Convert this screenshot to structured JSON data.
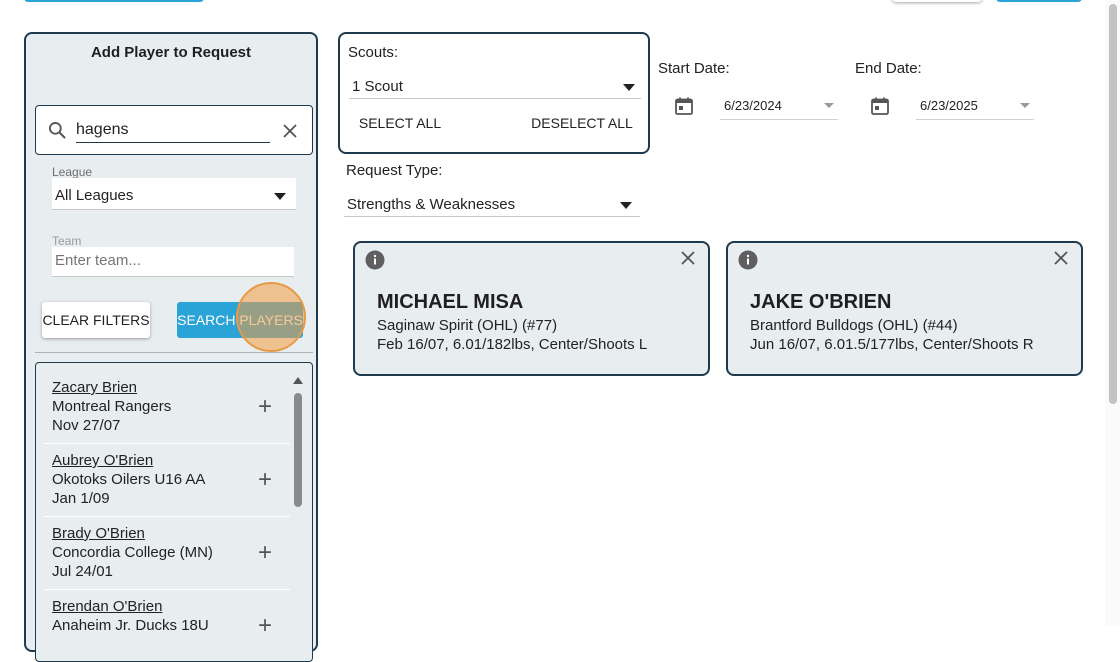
{
  "left_panel": {
    "title": "Add Player to Request",
    "search": {
      "value": "hagens",
      "placeholder": ""
    },
    "league": {
      "label": "League",
      "value": "All Leagues"
    },
    "team": {
      "label": "Team",
      "placeholder": "Enter team..."
    },
    "clear_filters_label": "CLEAR FILTERS",
    "search_players_label": "SEARCH PLAYERS",
    "results": [
      {
        "name": "Zacary Brien",
        "team": "Montreal Rangers",
        "dob": "Nov 27/07"
      },
      {
        "name": "Aubrey O'Brien",
        "team": "Okotoks Oilers U16 AA",
        "dob": "Jan 1/09"
      },
      {
        "name": "Brady O'Brien",
        "team": "Concordia College (MN)",
        "dob": "Jul 24/01"
      },
      {
        "name": "Brendan O'Brien",
        "team": "Anaheim Jr. Ducks 18U",
        "dob": ""
      }
    ]
  },
  "scouts": {
    "label": "Scouts:",
    "value": "1 Scout",
    "select_all_label": "SELECT ALL",
    "deselect_all_label": "DESELECT ALL"
  },
  "dates": {
    "start_label": "Start Date:",
    "start_value": "6/23/2024",
    "end_label": "End Date:",
    "end_value": "6/23/2025"
  },
  "request_type": {
    "label": "Request Type:",
    "value": "Strengths & Weaknesses"
  },
  "player_cards": [
    {
      "name": "MICHAEL MISA",
      "team_line": "Saginaw Spirit (OHL) (#77)",
      "details": "Feb 16/07, 6.01/182lbs, Center/Shoots L"
    },
    {
      "name": "JAKE O'BRIEN",
      "team_line": "Brantford Bulldogs (OHL) (#44)",
      "details": "Jun 16/07, 6.01.5/177lbs, Center/Shoots R"
    }
  ],
  "colors": {
    "panel_bg": "#e8edf0",
    "border": "#1e3a4f",
    "primary_button": "#2aa3d6",
    "click_indicator": "#f39c44"
  },
  "icons": {
    "search": "search-icon",
    "clear": "close-icon",
    "calendar": "calendar-icon",
    "info": "info-icon",
    "add": "plus-icon"
  }
}
